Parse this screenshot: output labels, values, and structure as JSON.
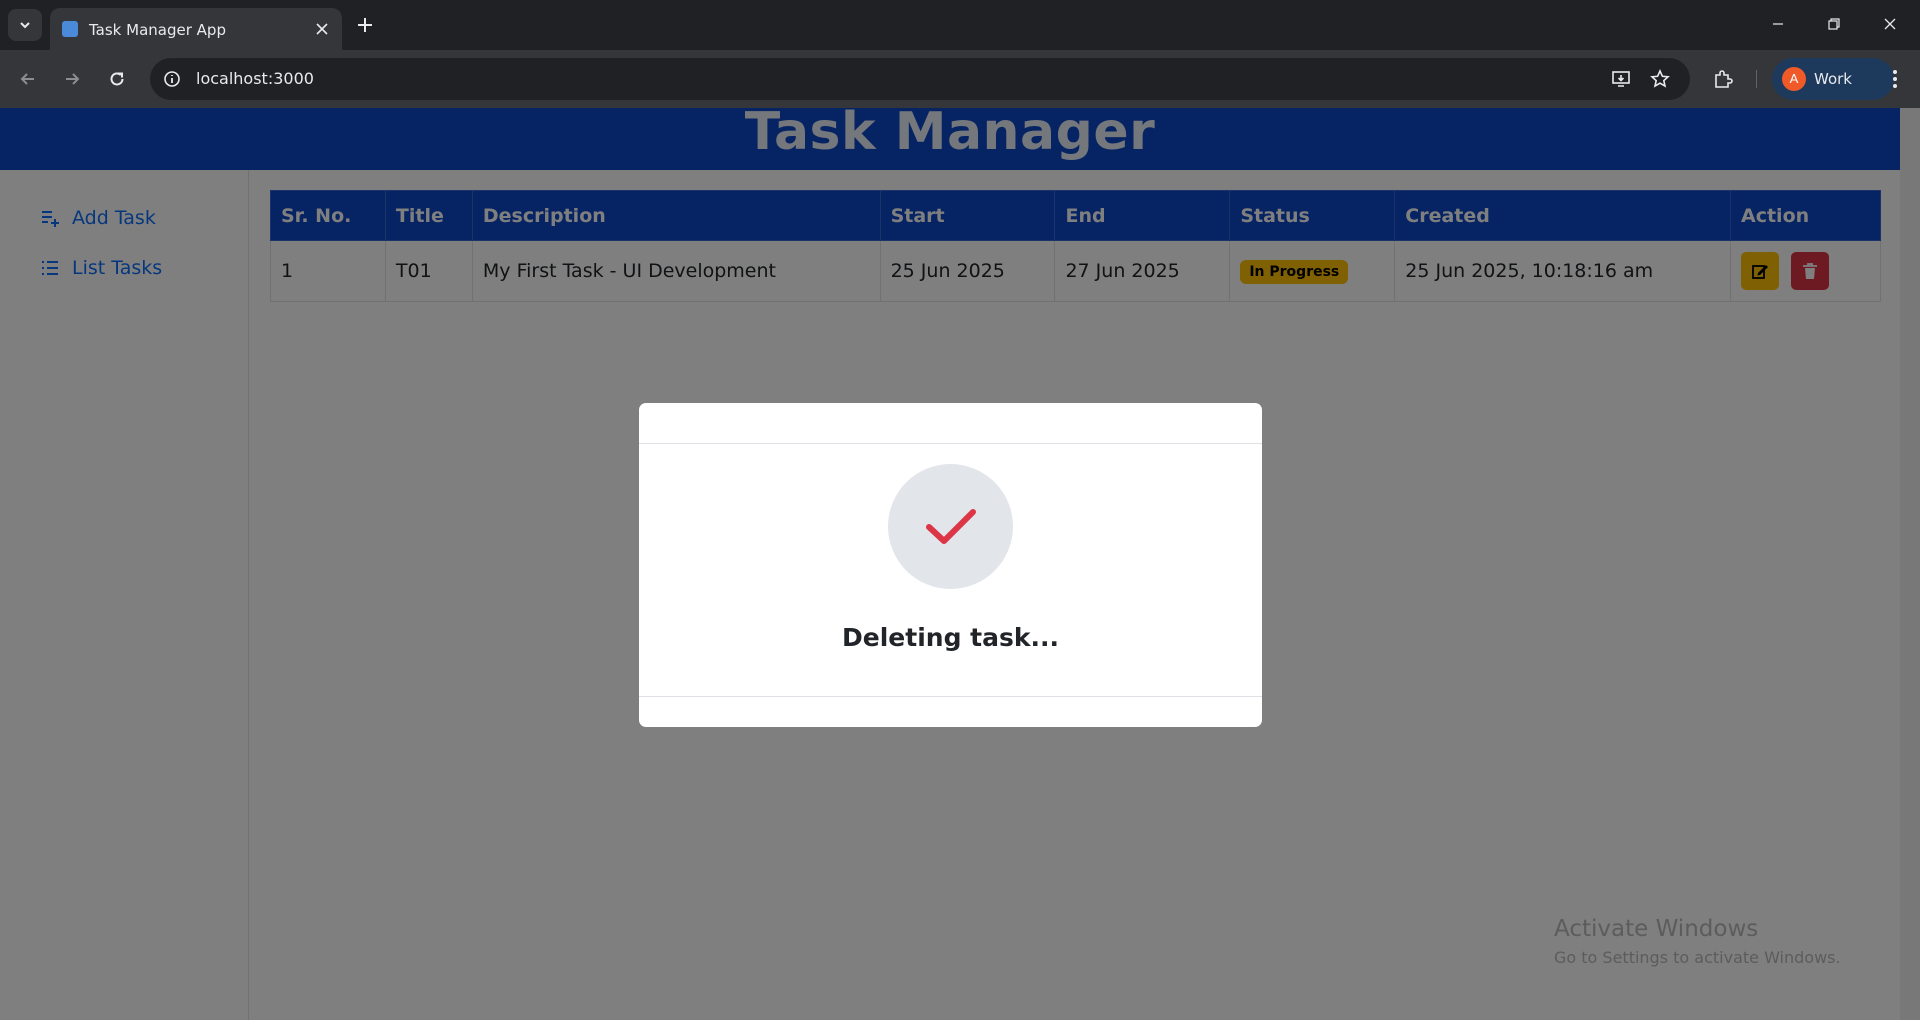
{
  "browser": {
    "tab_title": "Task Manager App",
    "url": "localhost:3000",
    "profile_initial": "A",
    "profile_name": "Work"
  },
  "app": {
    "title": "Task Manager"
  },
  "sidebar": {
    "items": [
      {
        "label": "Add Task",
        "icon": "add-task-icon"
      },
      {
        "label": "List Tasks",
        "icon": "list-icon"
      }
    ]
  },
  "table": {
    "headers": [
      "Sr. No.",
      "Title",
      "Description",
      "Start",
      "End",
      "Status",
      "Created",
      "Action"
    ],
    "rows": [
      {
        "sr": "1",
        "title": "T01",
        "description": "My First Task - UI Development",
        "start": "25 Jun 2025",
        "end": "27 Jun 2025",
        "status": "In Progress",
        "created": "25 Jun 2025, 10:18:16 am"
      }
    ]
  },
  "modal": {
    "message": "Deleting task..."
  },
  "watermark": {
    "line1": "Activate Windows",
    "line2": "Go to Settings to activate Windows."
  },
  "colors": {
    "primary": "#0d47c9",
    "warning": "#ffc107",
    "danger": "#dc3545",
    "check": "#dc3545"
  }
}
